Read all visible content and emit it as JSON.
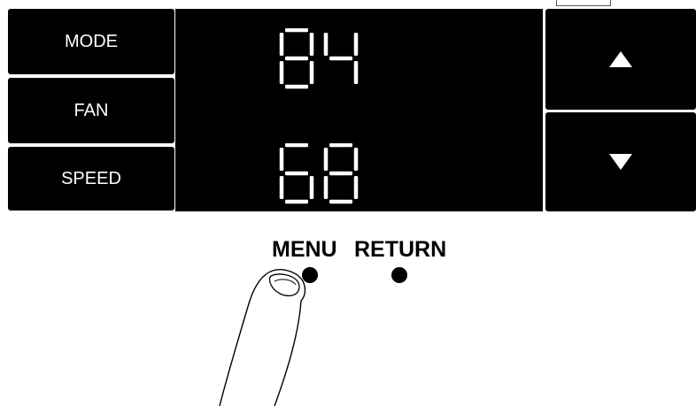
{
  "left_buttons": {
    "mode_label": "MODE",
    "fan_label": "FAN",
    "speed_label": "SPEED"
  },
  "display": {
    "top_value": "84",
    "bottom_value": "68",
    "segment_color": "#ffffff"
  },
  "arrows": {
    "up_icon": "triangle-up-icon",
    "down_icon": "triangle-down-icon"
  },
  "panel": {
    "menu_label": "MENU",
    "return_label": "RETURN"
  },
  "illustration": {
    "pointer": "finger-pressing-menu-button"
  }
}
